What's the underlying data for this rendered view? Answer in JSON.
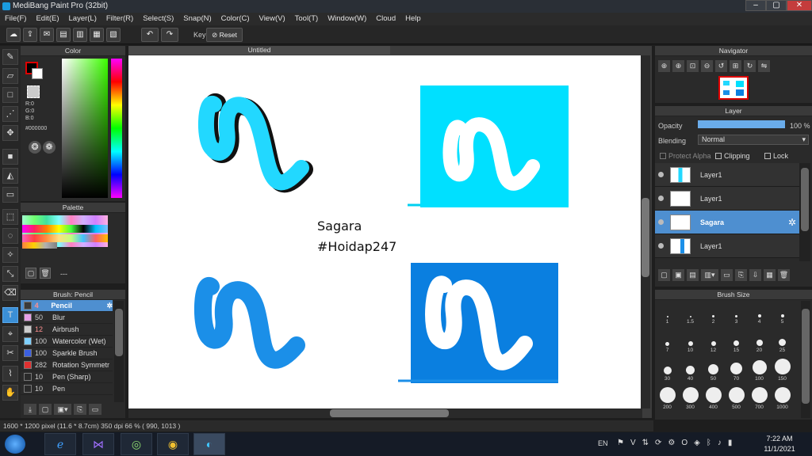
{
  "window": {
    "title": "MediBang Paint Pro (32bit)",
    "minimize": "–",
    "maximize": "▢",
    "close": "✕"
  },
  "menu": [
    "File(F)",
    "Edit(E)",
    "Layer(L)",
    "Filter(R)",
    "Select(S)",
    "Snap(N)",
    "Color(C)",
    "View(V)",
    "Tool(T)",
    "Window(W)",
    "Cloud",
    "Help"
  ],
  "toolbar": {
    "key_label": "Key",
    "reset_label": "Reset"
  },
  "color_panel": {
    "title": "Color",
    "r": "R:0",
    "g": "G:0",
    "b": "B:0",
    "hex": "#000000"
  },
  "palette_panel": {
    "title": "Palette",
    "footer": "---"
  },
  "brush_panel": {
    "title": "Brush: Pencil",
    "items": [
      {
        "size": "4",
        "name": "Pencil",
        "color": "#3a3a3a"
      },
      {
        "size": "50",
        "name": "Blur",
        "color": "#e8a0e8"
      },
      {
        "size": "12",
        "name": "Airbrush",
        "color": "#cccccc"
      },
      {
        "size": "100",
        "name": "Watercolor (Wet)",
        "color": "#7fd0ff"
      },
      {
        "size": "100",
        "name": "Sparkle Brush",
        "color": "#3b5fe0"
      },
      {
        "size": "282",
        "name": "Rotation Symmetr",
        "color": "#e03030"
      },
      {
        "size": "10",
        "name": "Pen (Sharp)",
        "color": "#2a2a2a"
      },
      {
        "size": "10",
        "name": "Pen",
        "color": "#2a2a2a"
      }
    ]
  },
  "document": {
    "tab_title": "Untitled",
    "text_line1": "Sagara",
    "text_line2": "#Hoidap247"
  },
  "navigator_panel": {
    "title": "Navigator"
  },
  "layer_panel": {
    "title": "Layer",
    "opacity_label": "Opacity",
    "opacity_value": "100 %",
    "opacity": 1.0,
    "blending_label": "Blending",
    "blending_value": "Normal",
    "protect_alpha": "Protect Alpha",
    "clipping": "Clipping",
    "lock": "Lock",
    "layers": [
      {
        "name": "Layer1",
        "selected": false
      },
      {
        "name": "Layer1",
        "selected": false
      },
      {
        "name": "Sagara",
        "selected": true
      },
      {
        "name": "Layer1",
        "selected": false
      }
    ]
  },
  "brush_size_panel": {
    "title": "Brush Size",
    "sizes": [
      "1",
      "1.5",
      "2",
      "3",
      "4",
      "5",
      "7",
      "10",
      "12",
      "15",
      "20",
      "25",
      "30",
      "40",
      "50",
      "70",
      "100",
      "150",
      "200",
      "300",
      "400",
      "500",
      "700",
      "1000"
    ]
  },
  "status": {
    "text": "1600 * 1200 pixel   (11.6 * 8.7cm)   350 dpi   66 %   ( 990, 1013 )"
  },
  "taskbar": {
    "lang": "EN",
    "time": "7:22 AM",
    "date": "11/1/2021"
  },
  "colors": {
    "accent": "#4e8fd0",
    "cyan": "#00e0ff",
    "blue": "#1b8fe8",
    "dark_blue": "#0a7fe0"
  }
}
